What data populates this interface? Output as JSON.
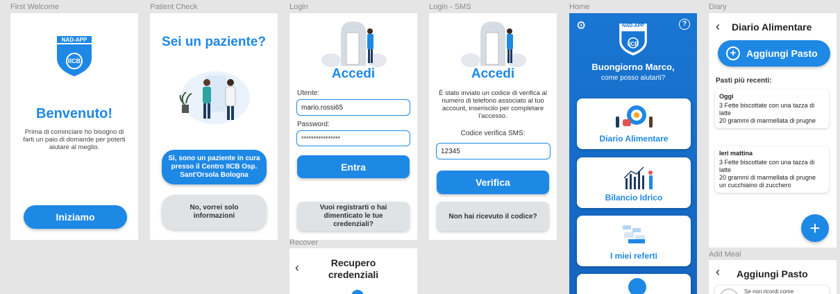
{
  "frames": {
    "first_welcome": {
      "label": "First Welcome",
      "logo_text": "NAD-APP",
      "logo_sub": "IICB",
      "title": "Benvenuto!",
      "body": "Prima di cominciare ho bisogno di farti un paio di domande per poterti aiutare al meglio.",
      "button": "Iniziamo"
    },
    "patient_check": {
      "label": "Patient Check",
      "title": "Sei un paziente?",
      "yes_button": "Sì, sono un paziente in cura presso il Centro IICB Osp. Sant'Orsola Bologna",
      "no_button": "No, vorrei solo informazioni"
    },
    "login": {
      "label": "Login",
      "title": "Accedi",
      "user_label": "Utente:",
      "user_value": "mario.rossi65",
      "password_label": "Password:",
      "password_value": "****************",
      "enter_button": "Entra",
      "register_button": "Vuoi registrarti o hai dimenticato le tue credenziali?"
    },
    "recover": {
      "label": "Recover",
      "title": "Recupero credenziali"
    },
    "login_sms": {
      "label": "Login - SMS",
      "title": "Accedi",
      "body": "È stato inviato un codice di verifica al numero di telefono associato al tuo account, inseriscilo per completare l'accesso.",
      "code_label": "Codice verifica SMS:",
      "code_value": "12345",
      "verify_button": "Verifica",
      "resend_button": "Non hai ricevuto il codice?"
    },
    "home": {
      "label": "Home",
      "logo_text": "NAD-APP",
      "logo_sub": "IICB",
      "greeting": "Buongiorno Marco,",
      "subtitle": "come posso aiutarti?",
      "cards": [
        "Diario Alimentare",
        "Bilancio Idrico",
        "I miei referti"
      ]
    },
    "diary": {
      "label": "Diary",
      "title": "Diario Alimentare",
      "add_button": "Aggiungi Pasto",
      "recent_label": "Pasti più recenti:",
      "meals": [
        {
          "day": "Oggi",
          "lines": [
            "3 Fette biscottate con una tazza di latte",
            "20 grammi di marmellata di prugne"
          ]
        },
        {
          "day": "Ieri mattina",
          "lines": [
            "3 Fette biscottate con una tazza di latte",
            "20 grammi di marmellata di prugne",
            "un cucchiaino di zucchero"
          ]
        }
      ],
      "fab": "+"
    },
    "add_meal": {
      "label": "Add Meal",
      "title": "Aggiungi Pasto",
      "hint": "Se non ricordi come"
    }
  },
  "colors": {
    "primary": "#1e88e5",
    "home_bg": "#1565c0",
    "grey_button": "#dfe3e6"
  }
}
